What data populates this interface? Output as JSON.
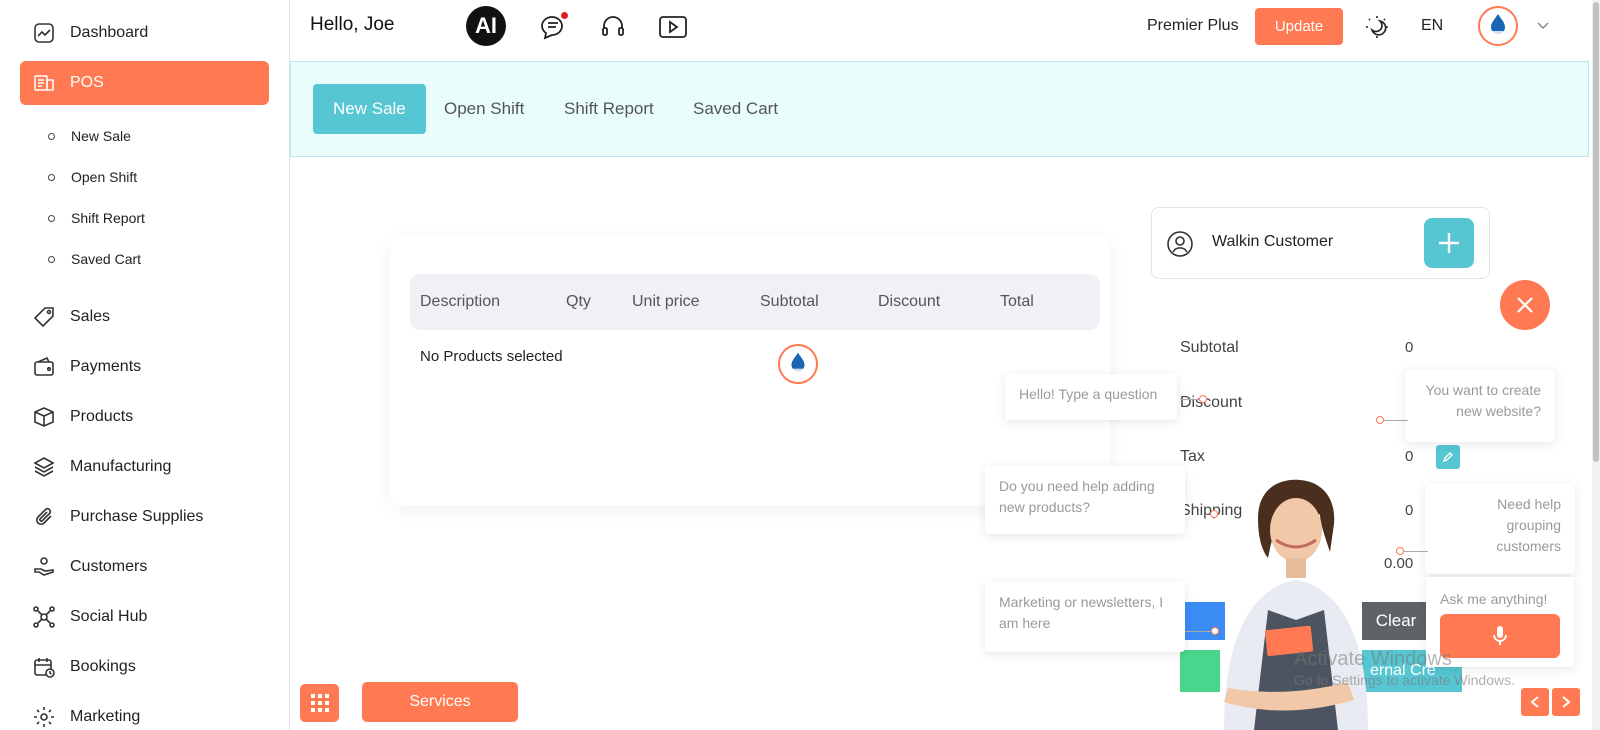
{
  "sidebar": {
    "items": [
      {
        "label": "Dashboard",
        "icon": "dashboard-icon"
      },
      {
        "label": "POS",
        "icon": "pos-icon"
      },
      {
        "label": "Sales",
        "icon": "tag-icon"
      },
      {
        "label": "Payments",
        "icon": "wallet-icon"
      },
      {
        "label": "Products",
        "icon": "box-icon"
      },
      {
        "label": "Manufacturing",
        "icon": "layers-icon"
      },
      {
        "label": "Purchase Supplies",
        "icon": "paperclip-icon"
      },
      {
        "label": "Customers",
        "icon": "hand-coins-icon"
      },
      {
        "label": "Social Hub",
        "icon": "network-icon"
      },
      {
        "label": "Bookings",
        "icon": "calendar-icon"
      },
      {
        "label": "Marketing",
        "icon": "gear-icon"
      }
    ],
    "sub_items": [
      "New Sale",
      "Open Shift",
      "Shift Report",
      "Saved Cart"
    ]
  },
  "header": {
    "greeting": "Hello, Joe",
    "ai_label": "AI",
    "plan": "Premier Plus",
    "update_label": "Update",
    "language": "EN"
  },
  "tabs": [
    "New Sale",
    "Open Shift",
    "Shift Report",
    "Saved Cart"
  ],
  "cart": {
    "columns": [
      "Description",
      "Qty",
      "Unit price",
      "Subtotal",
      "Discount",
      "Total"
    ],
    "empty_text": "No Products selected"
  },
  "customer": {
    "name": "Walkin Customer"
  },
  "totals": {
    "subtotal_label": "Subtotal",
    "subtotal_value": "0",
    "discount_label": "Discount",
    "tax_label": "Tax",
    "tax_value": "0",
    "shipping_label": "Shipping",
    "shipping_value": "0",
    "grand_value": "0.00"
  },
  "actions": {
    "clear_label": "Clear",
    "external_label": "ernal Cre"
  },
  "chat": {
    "bubble_question": "Hello! Type a question",
    "bubble_website": "You want to create new website?",
    "bubble_products": "Do you need help adding new products?",
    "bubble_grouping": "Need help grouping customers",
    "bubble_marketing": "Marketing or newsletters, I am here",
    "ask_placeholder": "Ask me anything!"
  },
  "watermark": {
    "title": "Activate Windows",
    "subtitle": "Go to Settings to activate Windows."
  },
  "bottom": {
    "services_label": "Services"
  },
  "colors": {
    "accent": "#ff7a53",
    "teal": "#56c6d3",
    "tab_bg": "#e9fdfd"
  }
}
